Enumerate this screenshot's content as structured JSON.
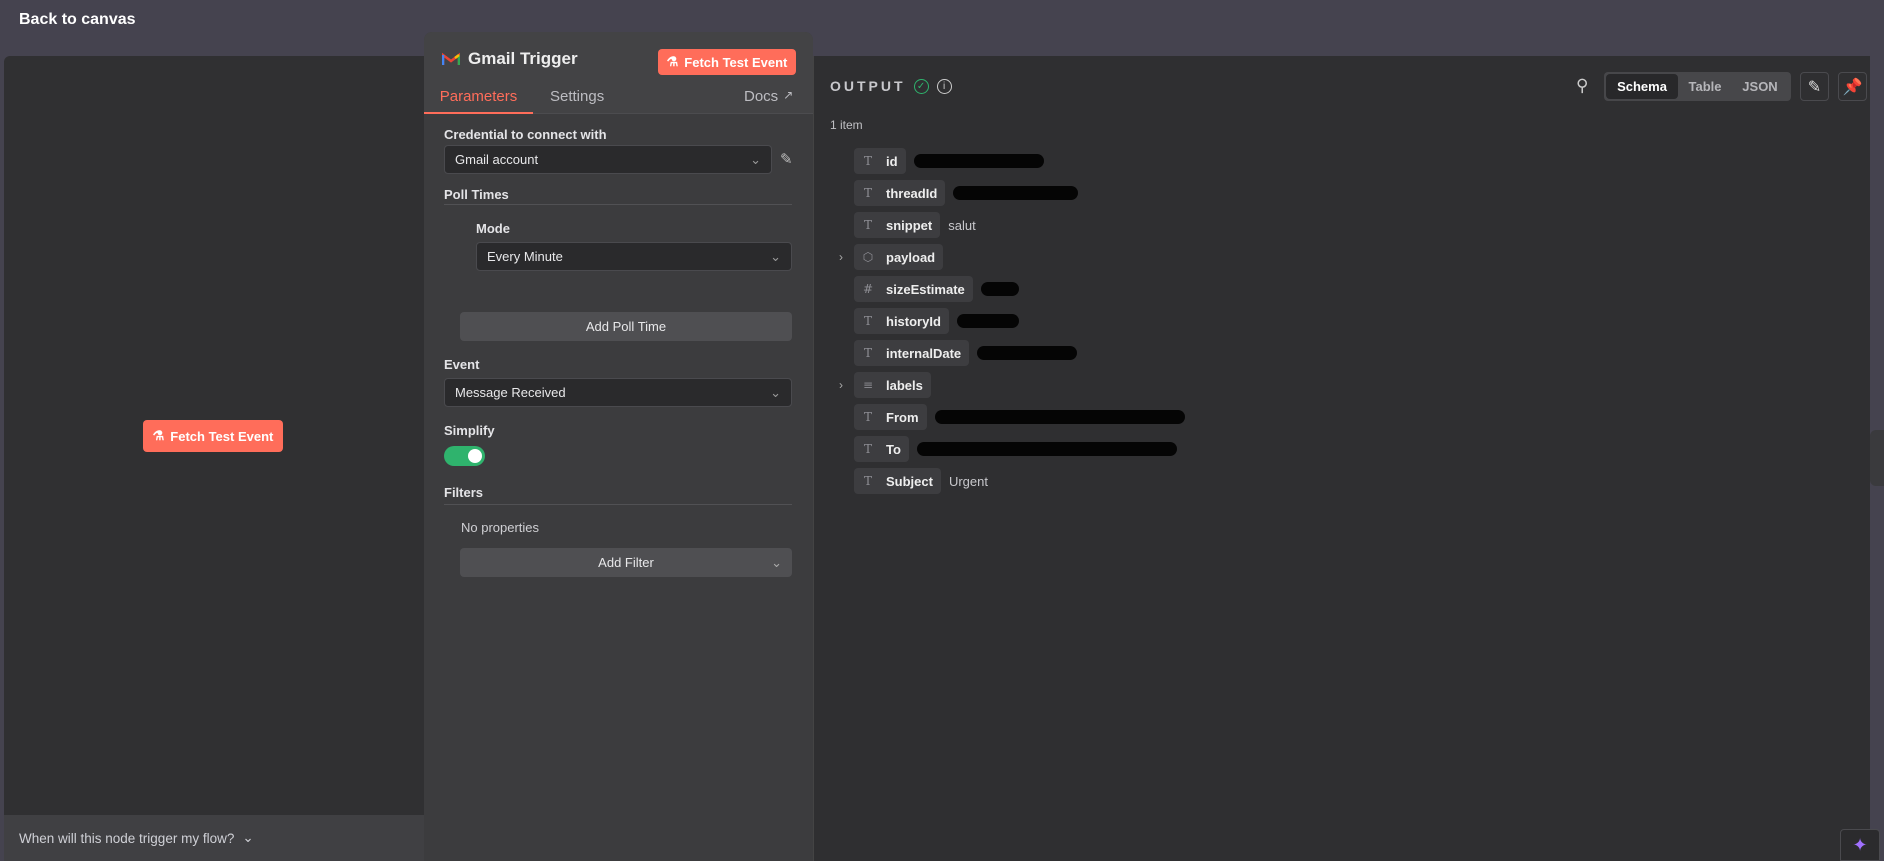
{
  "topbar": {
    "back_label": "Back to canvas"
  },
  "left_panel": {
    "fetch_button": "Fetch Test Event",
    "bottom_question": "When will this node trigger my flow?"
  },
  "node_panel": {
    "title": "Gmail Trigger",
    "fetch_button": "Fetch Test Event",
    "tabs": [
      {
        "label": "Parameters",
        "active": true
      },
      {
        "label": "Settings",
        "active": false
      }
    ],
    "docs_label": "Docs",
    "credential_label": "Credential to connect with",
    "credential_value": "Gmail account",
    "poll_times_label": "Poll Times",
    "mode_label": "Mode",
    "mode_value": "Every Minute",
    "add_poll_time": "Add Poll Time",
    "event_label": "Event",
    "event_value": "Message Received",
    "simplify_label": "Simplify",
    "simplify_on": true,
    "filters_label": "Filters",
    "no_properties": "No properties",
    "add_filter": "Add Filter"
  },
  "output": {
    "title": "OUTPUT",
    "item_count": "1 item",
    "views": [
      "Schema",
      "Table",
      "JSON"
    ],
    "active_view": "Schema",
    "fields": [
      {
        "name": "id",
        "type": "string",
        "value": null
      },
      {
        "name": "threadId",
        "type": "string",
        "value": null
      },
      {
        "name": "snippet",
        "type": "string",
        "value": "salut"
      },
      {
        "name": "payload",
        "type": "object",
        "value": null
      },
      {
        "name": "sizeEstimate",
        "type": "number",
        "value": null
      },
      {
        "name": "historyId",
        "type": "string",
        "value": null
      },
      {
        "name": "internalDate",
        "type": "string",
        "value": null
      },
      {
        "name": "labels",
        "type": "array",
        "value": null
      },
      {
        "name": "From",
        "type": "string",
        "value": null
      },
      {
        "name": "To",
        "type": "string",
        "value": null
      },
      {
        "name": "Subject",
        "type": "string",
        "value": "Urgent"
      }
    ]
  },
  "colors": {
    "accent": "#ff6d5a",
    "success": "#2fb36d",
    "toggle": "#2fb36d",
    "ai": "#a070ff"
  }
}
